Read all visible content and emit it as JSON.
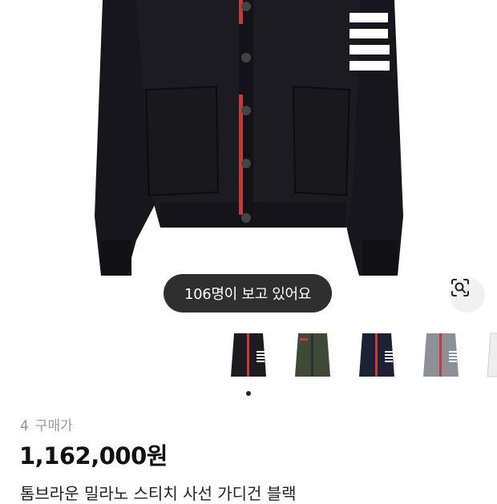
{
  "hero": {
    "viewer_badge": "106명이 보고 있어요",
    "lens_icon": "image-search-icon"
  },
  "variants": [
    {
      "name": "black cardigan",
      "body_color": "#1b1b20",
      "active": true
    },
    {
      "name": "green cardigan",
      "body_color": "#3f4a36",
      "active": false
    },
    {
      "name": "navy cardigan",
      "body_color": "#1c2233",
      "active": false
    },
    {
      "name": "grey cardigan",
      "body_color": "#8d9096",
      "active": false
    },
    {
      "name": "white cardigan",
      "body_color": "#eeeeee",
      "active": false
    }
  ],
  "price": {
    "count": "4",
    "label": "구매가",
    "value": "1,162,000원"
  },
  "product": {
    "title": "톰브라운 밀라노 스티치 사선 가디건 블랙"
  },
  "colors": {
    "garment": "#16161c",
    "stripe": "#ffffff",
    "placket_red": "#c8393b",
    "pill_bg": "#2f2f2f"
  }
}
